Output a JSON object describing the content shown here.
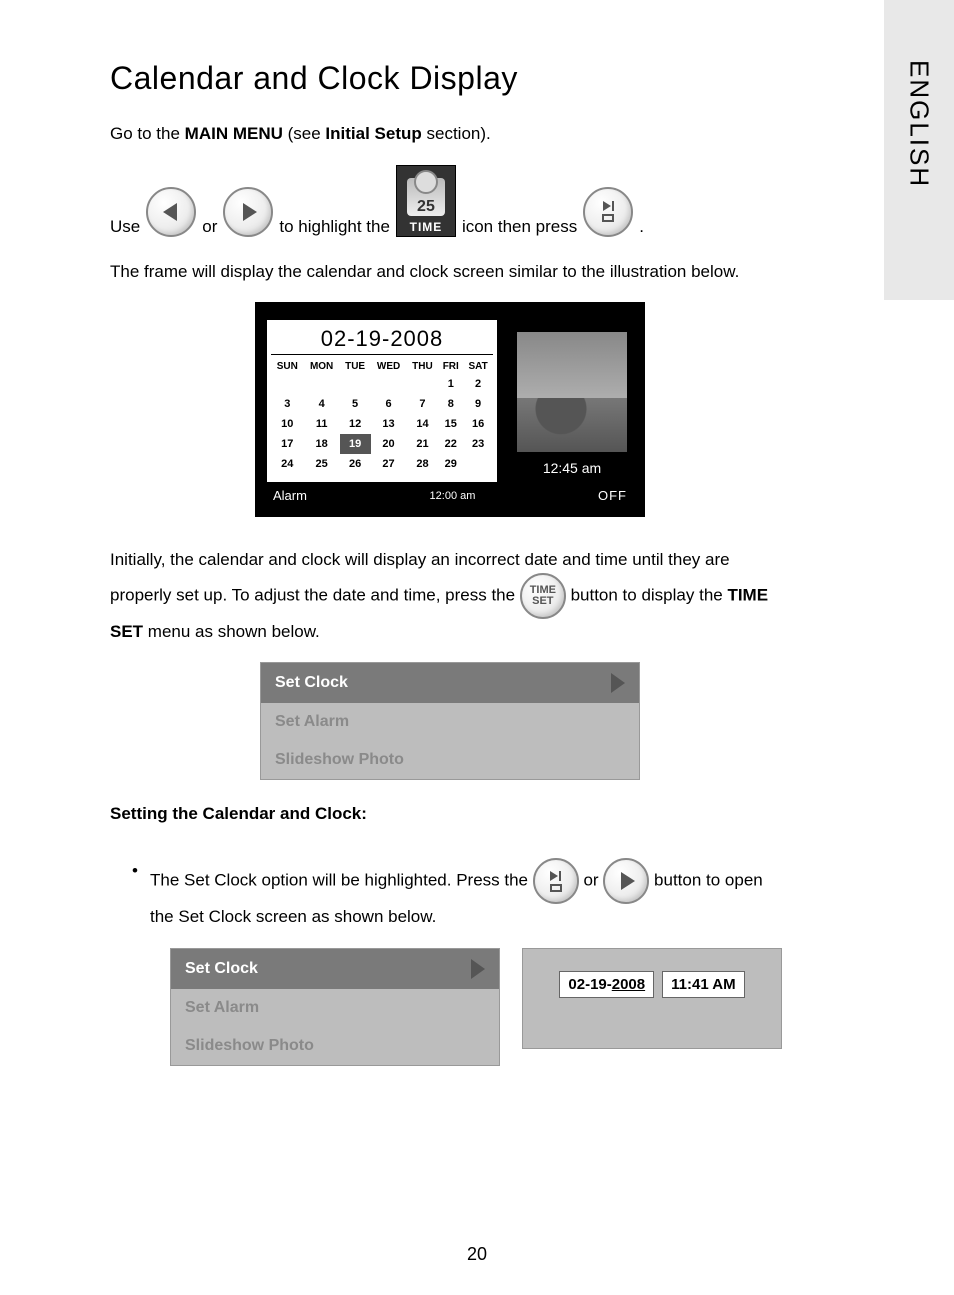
{
  "sidebar": {
    "language": "ENGLISH"
  },
  "title": "Calendar and Clock Display",
  "intro": {
    "pre": "Go to the ",
    "main_menu": "MAIN MENU",
    "mid": " (see ",
    "initial_setup": "Initial Setup",
    "post": " section)."
  },
  "line1": {
    "t1": "Use ",
    "t2": " or ",
    "t3": " to highlight the ",
    "t4": " icon then press ",
    "t5": " ."
  },
  "time_icon": {
    "day": "25",
    "label": "TIME"
  },
  "line2": "The frame will display the calendar and clock screen similar to the illustration below.",
  "calendar": {
    "date_header": "02-19-2008",
    "days": [
      "SUN",
      "MON",
      "TUE",
      "WED",
      "THU",
      "FRI",
      "SAT"
    ],
    "rows": [
      [
        "",
        "",
        "",
        "",
        "",
        "1",
        "2"
      ],
      [
        "3",
        "4",
        "5",
        "6",
        "7",
        "8",
        "9"
      ],
      [
        "10",
        "11",
        "12",
        "13",
        "14",
        "15",
        "16"
      ],
      [
        "17",
        "18",
        "19",
        "20",
        "21",
        "22",
        "23"
      ],
      [
        "24",
        "25",
        "26",
        "27",
        "28",
        "29",
        ""
      ]
    ],
    "highlight": "19",
    "clock": "12:45 am",
    "alarm_label": "Alarm",
    "alarm_time": "12:00 am",
    "alarm_state": "OFF"
  },
  "para2": {
    "a": "Initially, the calendar and clock will display an incorrect date and time until they are properly set up.  To adjust the date and time, press the ",
    "b": " button to display the ",
    "time_set_bold": "TIME SET",
    "c": " menu as shown below."
  },
  "timeset_btn": {
    "l1": "TIME",
    "l2": "SET"
  },
  "menu1": {
    "items": [
      "Set Clock",
      "Set Alarm",
      "Slideshow Photo"
    ]
  },
  "subhead": "Setting the Calendar and Clock:",
  "bullet1": {
    "a": "The ",
    "set_clock": "Set Clock",
    "b": " option will be highlighted. Press the ",
    "c": " or ",
    "d": " button to open the ",
    "set_clock2": "Set Clock",
    "e": " screen as shown below."
  },
  "menu2": {
    "items": [
      "Set Clock",
      "Set Alarm",
      "Slideshow Photo"
    ]
  },
  "setclock_panel": {
    "date_pre": "02-19-",
    "date_year": "2008",
    "time": "11:41 AM"
  },
  "page_number": "20"
}
